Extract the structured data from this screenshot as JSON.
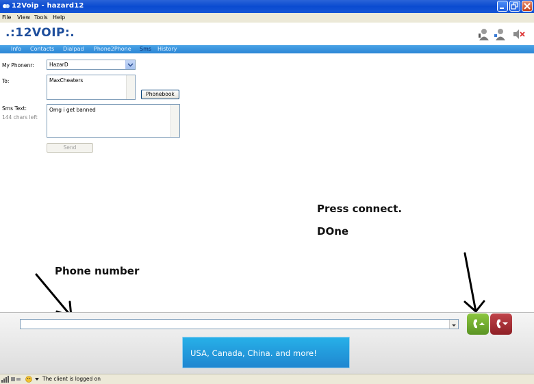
{
  "window": {
    "title": "12Voip - hazard12"
  },
  "menu": [
    "File",
    "View",
    "Tools",
    "Help"
  ],
  "logo": {
    "text": ".:12VOIP:."
  },
  "nav": {
    "tabs": [
      "Info",
      "Contacts",
      "Dialpad",
      "Phone2Phone",
      "Sms",
      "History"
    ],
    "active": "Sms"
  },
  "form": {
    "phonenr_label": "My Phonenr:",
    "phonenr_value": "HazarD",
    "to_label": "To:",
    "to_value": "MaxCheaters",
    "phonebook_button": "Phonebook",
    "sms_label": "Sms Text:",
    "chars_left": "144 chars left",
    "sms_value": "Omg i get banned",
    "send_button": "Send"
  },
  "annotations": {
    "press_connect": "Press connect.",
    "done": "DOne",
    "phone_number": "Phone number"
  },
  "dialer": {
    "phone_value": ""
  },
  "banner": {
    "text": "USA, Canada, China. and more!"
  },
  "status": {
    "text": "The client is logged on"
  },
  "colors": {
    "accent": "#2b86d6",
    "call_green": "#6aa52a",
    "hangup_red": "#a3262d"
  }
}
